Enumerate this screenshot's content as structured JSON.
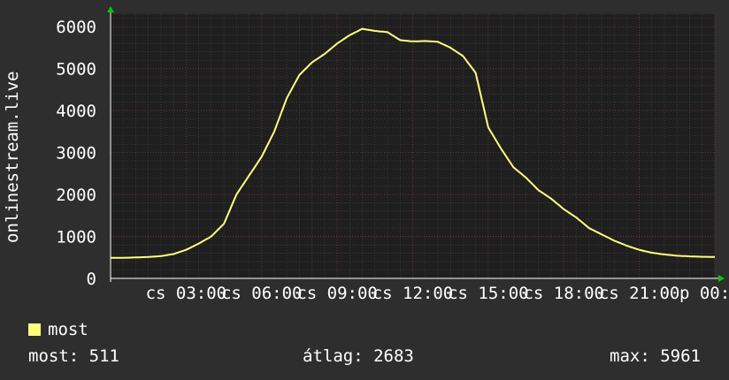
{
  "chart_data": {
    "type": "line",
    "ylabel": "onlinestream.live",
    "ylim": [
      0,
      6300
    ],
    "yticks": [
      0,
      1000,
      2000,
      3000,
      4000,
      5000,
      6000
    ],
    "x_range_hours": [
      0,
      24
    ],
    "xtick_labels": [
      "cs 03:00",
      "cs 06:00",
      "cs 09:00",
      "cs 12:00",
      "cs 15:00",
      "cs 18:00",
      "cs 21:00",
      "p 00:00"
    ],
    "xtick_hours": [
      3,
      6,
      9,
      12,
      15,
      18,
      21,
      24
    ],
    "grid": true,
    "series": [
      {
        "name": "most",
        "color": "#ffff80",
        "x": [
          0,
          0.5,
          1,
          1.5,
          2,
          2.5,
          3,
          3.5,
          4,
          4.5,
          5,
          5.5,
          6,
          6.5,
          7,
          7.5,
          8,
          8.5,
          9,
          9.5,
          10,
          10.5,
          11,
          11.5,
          12,
          12.5,
          13,
          13.5,
          14,
          14.5,
          15,
          15.5,
          16,
          16.5,
          17,
          17.5,
          18,
          18.5,
          19,
          19.5,
          20,
          20.5,
          21,
          21.5,
          22,
          22.5,
          23,
          23.5,
          24
        ],
        "values": [
          490,
          490,
          500,
          510,
          530,
          580,
          680,
          830,
          1000,
          1300,
          2000,
          2450,
          2900,
          3500,
          4300,
          4850,
          5150,
          5350,
          5600,
          5800,
          5950,
          5900,
          5870,
          5680,
          5650,
          5660,
          5640,
          5500,
          5300,
          4900,
          3600,
          3100,
          2650,
          2400,
          2100,
          1900,
          1650,
          1450,
          1200,
          1050,
          900,
          780,
          680,
          610,
          570,
          540,
          525,
          515,
          511
        ]
      }
    ]
  },
  "legend": {
    "series_label": "most"
  },
  "stats": {
    "current": "most: 511",
    "average": "átlag: 2683",
    "max": "max: 5961"
  }
}
